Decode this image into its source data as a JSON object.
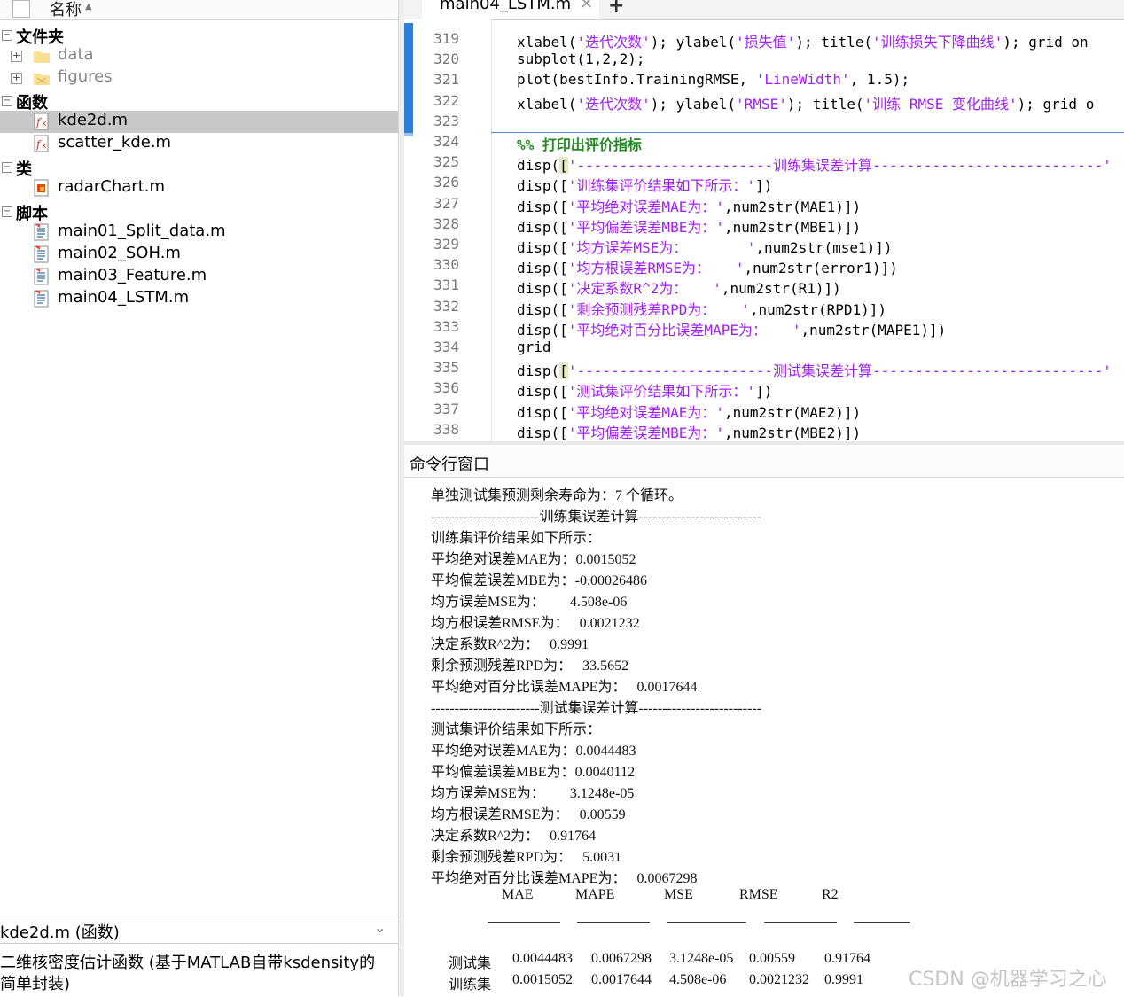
{
  "browser": {
    "column_header": "名称",
    "groups": [
      {
        "label": "文件夹"
      },
      {
        "label": "函数"
      },
      {
        "label": "类"
      },
      {
        "label": "脚本"
      }
    ],
    "items": [
      {
        "label": "data",
        "icon": "folder-icon"
      },
      {
        "label": "figures",
        "icon": "folder-icon"
      },
      {
        "label": "kde2d.m",
        "icon": "function-file-icon"
      },
      {
        "label": "scatter_kde.m",
        "icon": "function-file-icon"
      },
      {
        "label": "radarChart.m",
        "icon": "class-file-icon"
      },
      {
        "label": "main01_Split_data.m",
        "icon": "script-file-icon"
      },
      {
        "label": "main02_SOH.m",
        "icon": "script-file-icon"
      },
      {
        "label": "main03_Feature.m",
        "icon": "script-file-icon"
      },
      {
        "label": "main04_LSTM.m",
        "icon": "script-file-icon"
      }
    ],
    "details": {
      "title": "kde2d.m (函数)",
      "description": "二维核密度估计函数 (基于MATLAB自带ksdensity的简单封装)"
    }
  },
  "editor": {
    "tab_label": "main04_LSTM.m",
    "lines": [
      {
        "n": "319",
        "code": "xlabel('迭代次数'); ylabel('损失值'); title('训练损失下降曲线'); grid on"
      },
      {
        "n": "320",
        "code": "subplot(1,2,2);"
      },
      {
        "n": "321",
        "code": "plot(bestInfo.TrainingRMSE, 'LineWidth', 1.5);"
      },
      {
        "n": "322",
        "code": "xlabel('迭代次数'); ylabel('RMSE'); title('训练 RMSE 变化曲线'); grid o"
      },
      {
        "n": "323",
        "code": ""
      },
      {
        "n": "324",
        "code": "%% 打印出评价指标"
      },
      {
        "n": "325",
        "code": "disp(['-----------------------训练集误差计算---------------------------'"
      },
      {
        "n": "326",
        "code": "disp(['训练集评价结果如下所示：'])"
      },
      {
        "n": "327",
        "code": "disp(['平均绝对误差MAE为：',num2str(MAE1)])"
      },
      {
        "n": "328",
        "code": "disp(['平均偏差误差MBE为：',num2str(MBE1)])"
      },
      {
        "n": "329",
        "code": "disp(['均方误差MSE为：       ',num2str(mse1)])"
      },
      {
        "n": "330",
        "code": "disp(['均方根误差RMSE为：   ',num2str(error1)])"
      },
      {
        "n": "331",
        "code": "disp(['决定系数R^2为：   ',num2str(R1)])"
      },
      {
        "n": "332",
        "code": "disp(['剩余预测残差RPD为：   ',num2str(RPD1)])"
      },
      {
        "n": "333",
        "code": "disp(['平均绝对百分比误差MAPE为：   ',num2str(MAPE1)])"
      },
      {
        "n": "334",
        "code": "grid"
      },
      {
        "n": "335",
        "code": "disp(['-----------------------测试集误差计算---------------------------'"
      },
      {
        "n": "336",
        "code": "disp(['测试集评价结果如下所示：'])"
      },
      {
        "n": "337",
        "code": "disp(['平均绝对误差MAE为：',num2str(MAE2)])"
      },
      {
        "n": "338",
        "code": "disp(['平均偏差误差MBE为：',num2str(MBE2)])"
      }
    ]
  },
  "command_window": {
    "title": "命令行窗口",
    "lines": [
      "单独测试集预测剩余寿命为：7 个循环。",
      "-----------------------训练集误差计算--------------------------",
      "训练集评价结果如下所示：",
      "平均绝对误差MAE为：0.0015052",
      "平均偏差误差MBE为：-0.00026486",
      "均方误差MSE为：       4.508e-06",
      "均方根误差RMSE为：   0.0021232",
      "决定系数R^2为：   0.9991",
      "剩余预测残差RPD为：   33.5652",
      "平均绝对百分比误差MAPE为：   0.0017644",
      "-----------------------测试集误差计算--------------------------",
      "测试集评价结果如下所示：",
      "平均绝对误差MAE为：0.0044483",
      "平均偏差误差MBE为：0.0040112",
      "均方误差MSE为：       3.1248e-05",
      "均方根误差RMSE为：   0.00559",
      "决定系数R^2为：   0.91764",
      "剩余预测残差RPD为：   5.0031",
      "平均绝对百分比误差MAPE为：   0.0067298"
    ],
    "table": {
      "columns": [
        "MAE",
        "MAPE",
        "MSE",
        "RMSE",
        "R2"
      ],
      "rows": [
        {
          "label": "测试集",
          "values": [
            "0.0044483",
            "0.0067298",
            "3.1248e-05",
            "0.00559",
            "0.91764"
          ]
        },
        {
          "label": "训练集",
          "values": [
            "0.0015052",
            "0.0017644",
            "4.508e-06",
            "0.0021232",
            "0.9991"
          ]
        }
      ]
    }
  },
  "watermark": "CSDN @机器学习之心",
  "colors": {
    "selection": "#c8c8c8",
    "string": "#a020f0",
    "comment": "#228b22",
    "cell_marker": "#2d7fdc"
  }
}
